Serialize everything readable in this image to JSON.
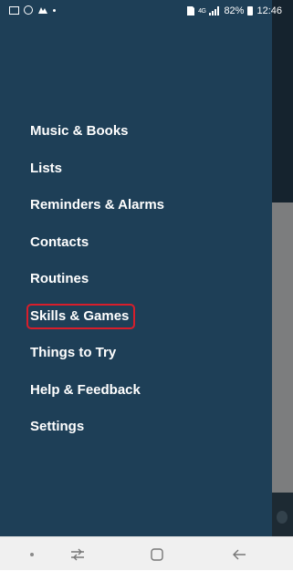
{
  "status_bar": {
    "left_icons": [
      "gallery-icon",
      "circle-icon",
      "notification-icon",
      "dot-icon"
    ],
    "signal": "4G",
    "battery": "82%",
    "time": "12:46"
  },
  "menu": {
    "items": [
      {
        "label": "Music & Books"
      },
      {
        "label": "Lists"
      },
      {
        "label": "Reminders & Alarms"
      },
      {
        "label": "Contacts"
      },
      {
        "label": "Routines"
      },
      {
        "label": "Skills & Games",
        "highlighted": true
      },
      {
        "label": "Things to Try"
      },
      {
        "label": "Help & Feedback"
      },
      {
        "label": "Settings"
      }
    ],
    "highlight_color": "#d81e2b"
  },
  "colors": {
    "drawer_background": "#1e3f57",
    "text": "#ffffff"
  },
  "nav_bar": {
    "buttons": [
      "dot-indicator",
      "recent-apps-icon",
      "home-icon",
      "back-icon"
    ]
  }
}
